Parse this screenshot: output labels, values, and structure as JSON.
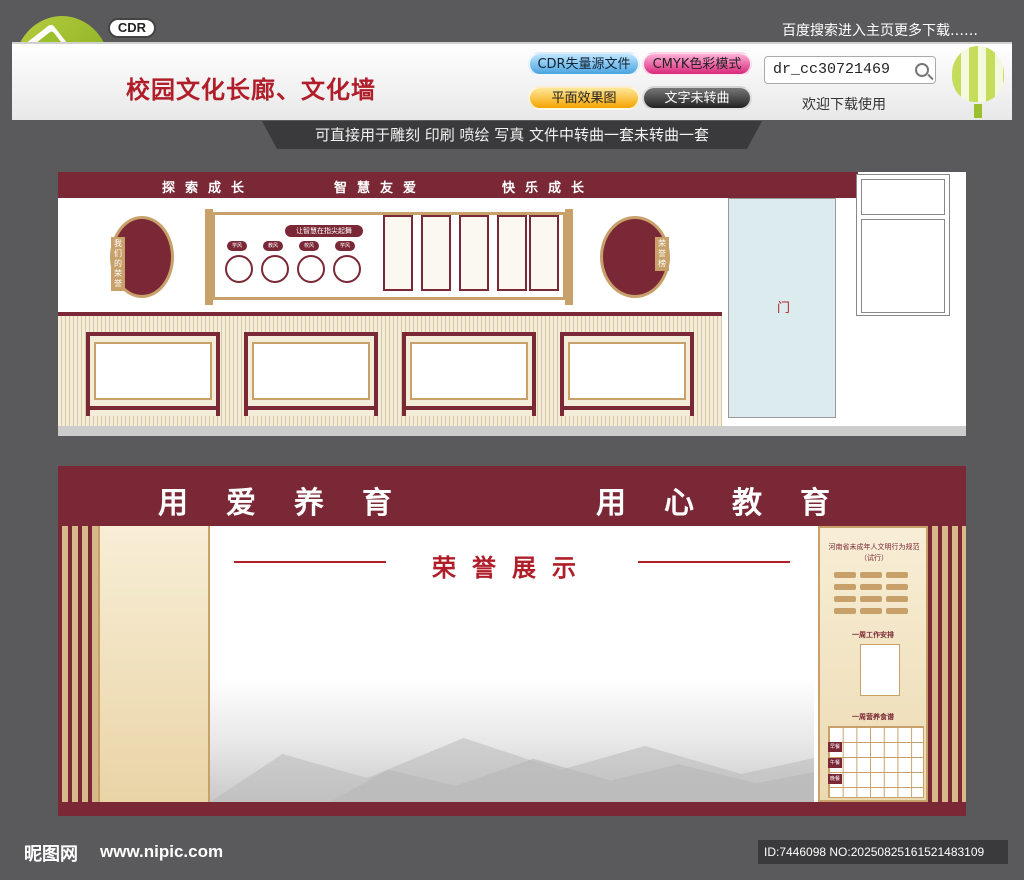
{
  "header": {
    "cdr_badge": "CDR",
    "title": "校园文化长廊、文化墙",
    "top_note": "百度搜索进入主页更多下载……",
    "buttons": {
      "cdr_vector": "CDR失量源文件",
      "cmyk": "CMYK色彩模式",
      "flat_preview": "平面效果图",
      "text_not_converted": "文字未转曲"
    },
    "search_value": "dr_cc30721469",
    "welcome": "欢迎下载使用",
    "subtitle": "可直接用于雕刻 印刷 喷绘 写真  文件中转曲一套未转曲一套"
  },
  "panel1": {
    "topbar": [
      "探索成长",
      "智慧友爱",
      "快乐成长"
    ],
    "left_round_label": "我们的荣誉",
    "right_round_label": "荣誉榜",
    "scroll_title": "让智慧在指尖起舞",
    "mini_tabs": [
      "学风",
      "教风",
      "校风",
      "学风"
    ],
    "door_label": "门"
  },
  "panel2": {
    "slogan_left": "用爱养育",
    "slogan_right": "用心教育",
    "honor_title": "荣誉展示",
    "board_title": "河南省未成年人文明行为规范（试行）",
    "weekly_plan": "一周工作安排",
    "weekly_menu": "一周营养食谱",
    "meal_rows": [
      "早餐",
      "午餐",
      "晚餐"
    ]
  },
  "footer": {
    "brand": "昵图网",
    "url": "www.nipic.com",
    "id_text": "ID:7446098 NO:20250825161521483109"
  },
  "colors": {
    "maroon": "#7a2836",
    "gold": "#c8a06a",
    "title_red": "#b01e2a",
    "background": "#5a5a5c"
  }
}
